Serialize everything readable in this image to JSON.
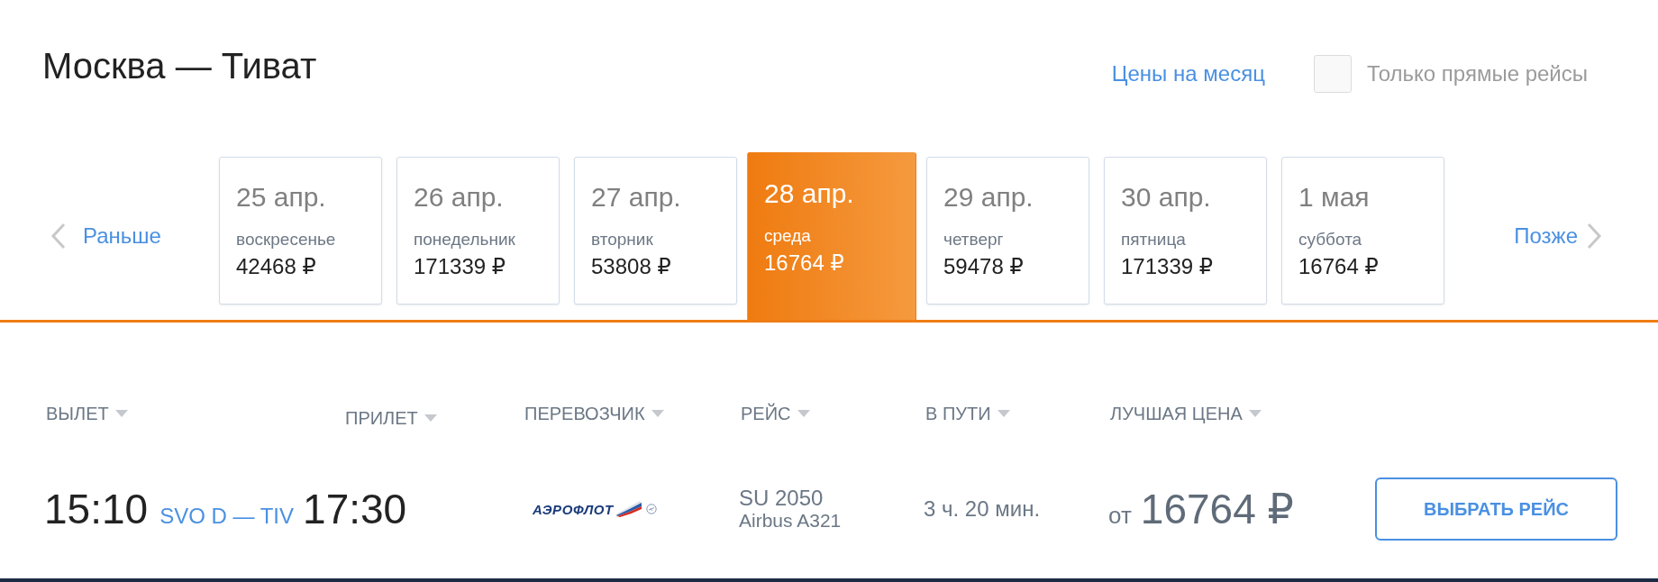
{
  "header": {
    "title": "Москва — Тиват",
    "month_prices_link": "Цены на месяц",
    "direct_only": {
      "label": "Только прямые рейсы",
      "checked": false
    }
  },
  "date_strip": {
    "earlier": "Раньше",
    "later": "Позже",
    "days": [
      {
        "date": "25 апр.",
        "weekday": "воскресенье",
        "price": "42468 ₽",
        "selected": false
      },
      {
        "date": "26 апр.",
        "weekday": "понедельник",
        "price": "171339 ₽",
        "selected": false
      },
      {
        "date": "27 апр.",
        "weekday": "вторник",
        "price": "53808 ₽",
        "selected": false
      },
      {
        "date": "28 апр.",
        "weekday": "среда",
        "price": "16764 ₽",
        "selected": true
      },
      {
        "date": "29 апр.",
        "weekday": "четверг",
        "price": "59478 ₽",
        "selected": false
      },
      {
        "date": "30 апр.",
        "weekday": "пятница",
        "price": "171339 ₽",
        "selected": false
      },
      {
        "date": "1 мая",
        "weekday": "суббота",
        "price": "16764 ₽",
        "selected": false
      }
    ]
  },
  "results": {
    "columns": [
      {
        "label": "ВЫЛЕТ"
      },
      {
        "label": "ПРИЛЕТ"
      },
      {
        "label": "ПЕРЕВОЗЧИК"
      },
      {
        "label": "РЕЙС"
      },
      {
        "label": "В ПУТИ"
      },
      {
        "label": "ЛУЧШАЯ ЦЕНА"
      }
    ],
    "rows": [
      {
        "departure_time": "15:10",
        "route": "SVO D — TIV",
        "arrival_time": "17:30",
        "carrier": "АЭРОФЛОТ",
        "flight": "SU 2050",
        "aircraft": "Airbus A321",
        "duration": "3 ч. 20 мин.",
        "price_prefix": "от",
        "price": "16764 ₽",
        "action": "ВЫБРАТЬ РЕЙС"
      }
    ]
  }
}
